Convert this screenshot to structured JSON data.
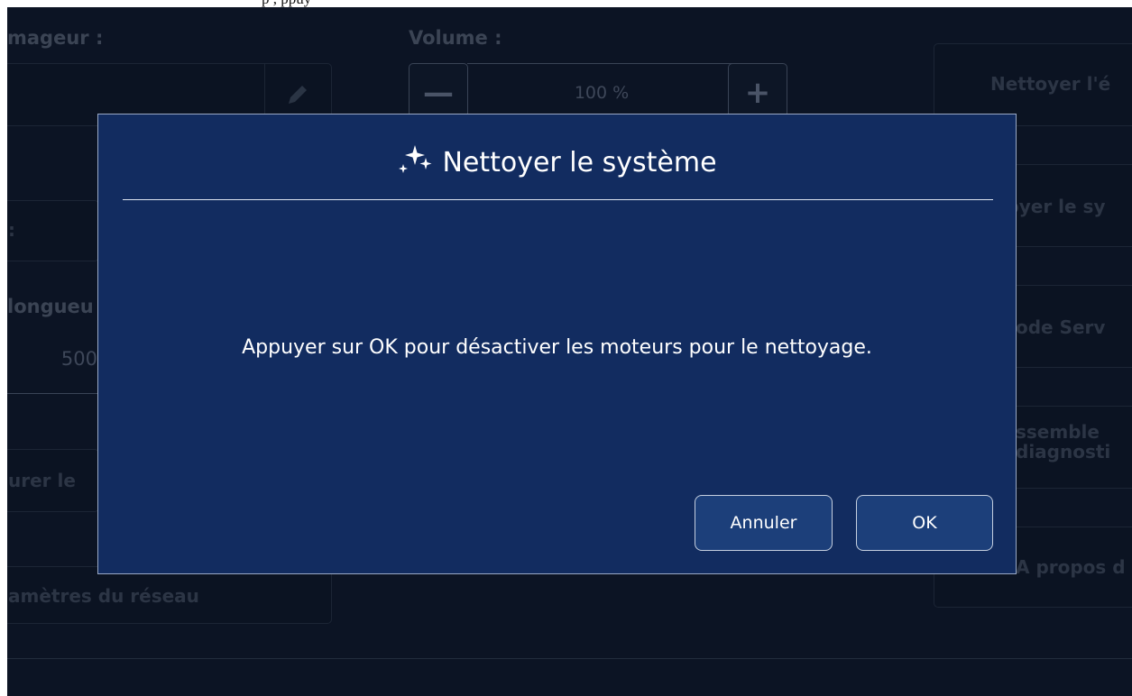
{
  "top_strip": {
    "text": "p                                    ,  ppuy"
  },
  "background": {
    "label_imager": "mageur :",
    "label_volume": "Volume :",
    "volume_value": "100 %",
    "volume_minus": "—",
    "volume_plus": "+",
    "label_length": "longueu",
    "length_value": "500",
    "left_fragment": ":",
    "configure_btn": "urer le",
    "network_btn": "amètres du réseau",
    "side_clean_screen": "Nettoyer l'é",
    "side_clean_system": "oyer le sy",
    "side_service": "ode Serv",
    "side_diag_1": "ssemble",
    "side_diag_2": "diagnosti",
    "side_about": "A propos d"
  },
  "dialog": {
    "title": "Nettoyer le système",
    "icon": "sparkle-icon",
    "message": "Appuyer sur OK pour désactiver les moteurs pour le nettoyage.",
    "cancel_label": "Annuler",
    "ok_label": "OK"
  },
  "colors": {
    "dialog_bg": "#122c60",
    "screen_bg": "#0c1424",
    "button_bg": "#1c3f7a"
  }
}
